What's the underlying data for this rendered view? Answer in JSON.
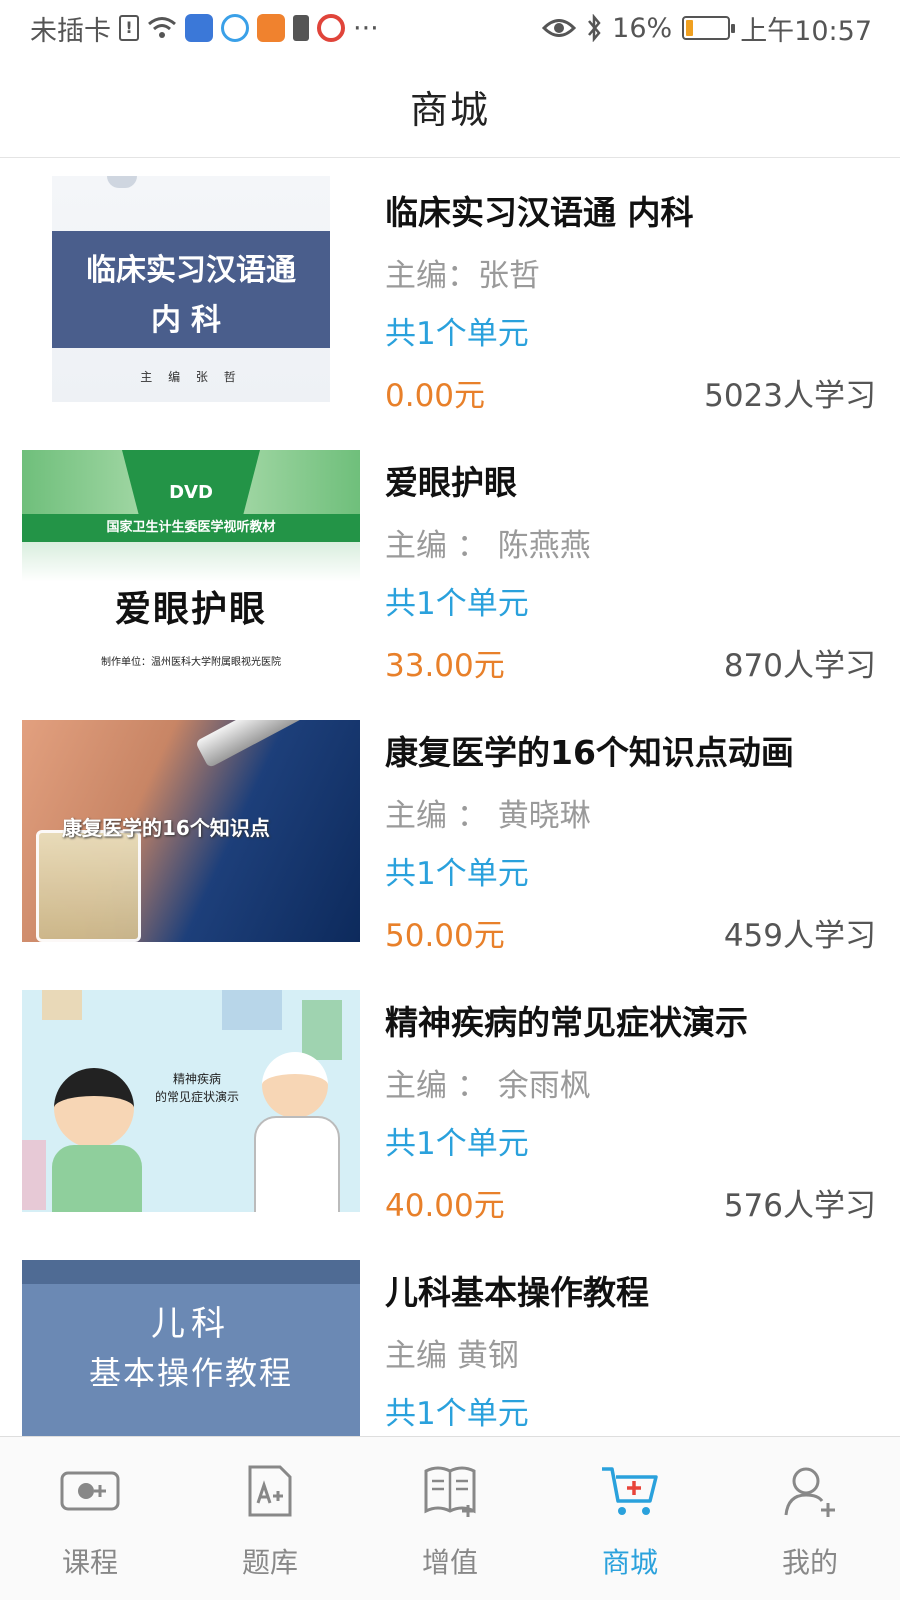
{
  "status_bar": {
    "carrier": "未插卡",
    "more": "···",
    "battery_percent": "16%",
    "battery_level": 0.16,
    "time": "上午10:57",
    "icons": [
      "sim-alert-icon",
      "wifi-icon",
      "app-icon",
      "cloud-app-icon",
      "uc-browser-icon",
      "warning-icon",
      "weibo-icon",
      "eye-icon",
      "bluetooth-icon",
      "battery-icon"
    ]
  },
  "header": {
    "title": "商城"
  },
  "courses": [
    {
      "title": "临床实习汉语通 内科",
      "editor": "主编：张哲",
      "units": "共1个单元",
      "price": "0.00元",
      "learners": "5023人学习",
      "thumb": {
        "line1": "临床实习汉语通",
        "line2": "内科",
        "small": "主 编 张 哲"
      }
    },
    {
      "title": "爱眼护眼",
      "editor": "主编 ： 陈燕燕",
      "units": "共1个单元",
      "price": "33.00元",
      "learners": "870人学习",
      "thumb": {
        "badge": "DVD",
        "subtitle": "国家卫生计生委医学视听教材",
        "big": "爱眼护眼",
        "foot": "制作单位：温州医科大学附属眼视光医院"
      }
    },
    {
      "title": "康复医学的16个知识点动画",
      "editor": "主编 ： 黄晓琳",
      "units": "共1个单元",
      "price": "50.00元",
      "learners": "459人学习",
      "thumb": {
        "caption": "康复医学的16个知识点"
      }
    },
    {
      "title": "精神疾病的常见症状演示",
      "editor": "主编 ： 余雨枫",
      "units": "共1个单元",
      "price": "40.00元",
      "learners": "576人学习",
      "thumb": {
        "line1": "精神疾病",
        "line2": "的常见症状演示"
      }
    },
    {
      "title": "儿科基本操作教程",
      "editor": "主编 黄钢",
      "units": "共1个单元",
      "price": "",
      "learners": "",
      "thumb": {
        "line1": "儿科",
        "line2": "基本操作教程"
      }
    }
  ],
  "bottom_nav": {
    "items": [
      {
        "label": "课程",
        "icon": "course-icon",
        "active": false
      },
      {
        "label": "题库",
        "icon": "question-bank-icon",
        "active": false
      },
      {
        "label": "增值",
        "icon": "book-plus-icon",
        "active": false
      },
      {
        "label": "商城",
        "icon": "cart-icon",
        "active": true
      },
      {
        "label": "我的",
        "icon": "user-add-icon",
        "active": false
      }
    ],
    "active_color": "#2aa1dc",
    "inactive_color": "#888888"
  },
  "colors": {
    "units": "#2aa1dc",
    "price": "#e8802a",
    "editor": "#9a9a9a"
  }
}
